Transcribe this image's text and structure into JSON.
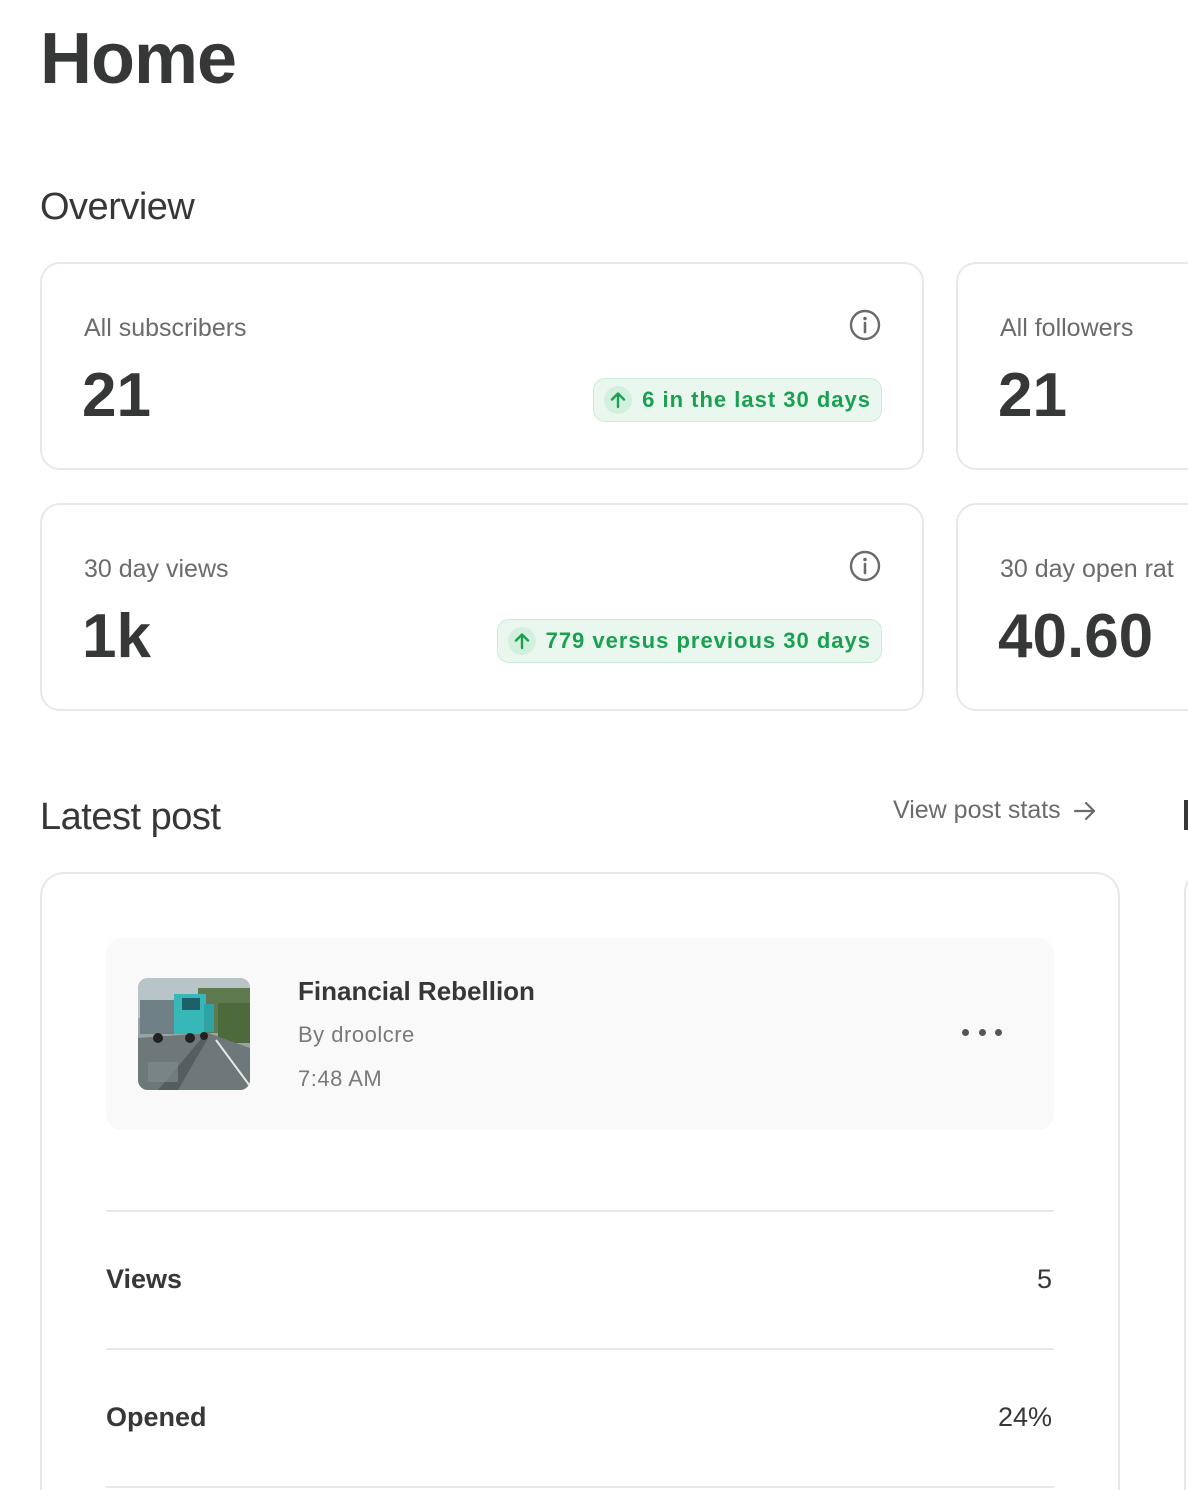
{
  "page": {
    "title": "Home"
  },
  "overview": {
    "title": "Overview",
    "cards": [
      {
        "label": "All subscribers",
        "value": "21",
        "badge": "6 in the last 30 days"
      },
      {
        "label": "All followers",
        "value": "21"
      },
      {
        "label": "30 day views",
        "value": "1k",
        "badge": "779 versus previous 30 days"
      },
      {
        "label": "30 day open rat",
        "value": "40.60"
      }
    ]
  },
  "latest_post": {
    "title": "Latest post",
    "view_stats_label": "View post stats",
    "post": {
      "title": "Financial Rebellion",
      "author": "By droolcre",
      "time": "7:48 AM"
    },
    "metrics": [
      {
        "label": "Views",
        "value": "5"
      },
      {
        "label": "Opened",
        "value": "24%"
      }
    ]
  },
  "colors": {
    "text": "#363737",
    "muted": "#6b6b6b",
    "positive": "#1aa050",
    "positive_bg": "#eaf7ef",
    "border": "#e8e8e8"
  }
}
